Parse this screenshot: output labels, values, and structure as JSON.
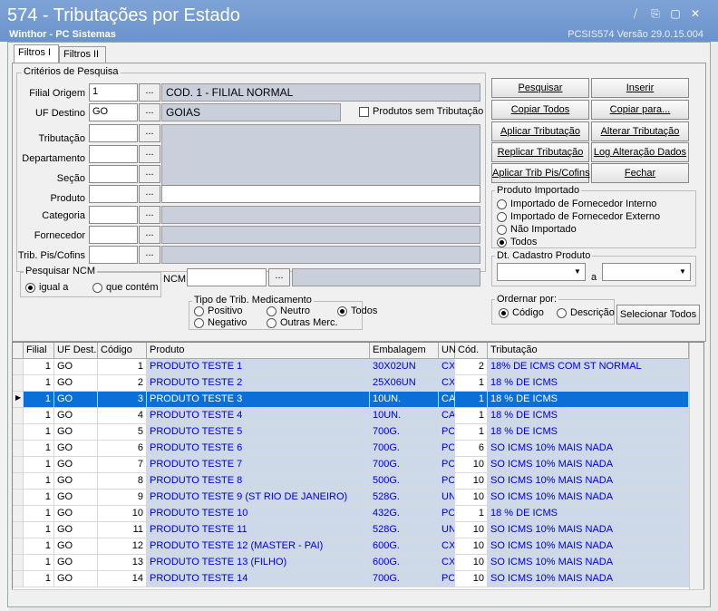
{
  "window": {
    "title": "574 - Tributações por Estado",
    "subtitle": "Winthor - PC Sistemas",
    "version": "PCSIS574  Versão  29.0.15.004",
    "controls": [
      "⧸",
      "⎘",
      "▢",
      "✕"
    ]
  },
  "tabs": [
    {
      "label": "Filtros I"
    },
    {
      "label": "Filtros II"
    }
  ],
  "criteria": {
    "group_label": "Critérios de Pesquisa",
    "filial_label": "Filial Origem",
    "filial_value": "1",
    "filial_desc": "COD. 1 - FILIAL NORMAL",
    "uf_label": "UF Destino",
    "uf_value": "GO",
    "uf_desc": "GOIAS",
    "sem_trib_label": "Produtos sem Tributação",
    "tributacao_label": "Tributação",
    "departamento_label": "Departamento",
    "secao_label": "Seção",
    "produto_label": "Produto",
    "categoria_label": "Categoria",
    "fornecedor_label": "Fornecedor",
    "pis_label": "Trib. Pis/Cofins",
    "dots": "..."
  },
  "ncm": {
    "group_label": "Pesquisar NCM",
    "igual_label": "igual a",
    "contem_label": "que contém",
    "ncm_label": "NCM"
  },
  "medicamento": {
    "group_label": "Tipo de Trib. Medicamento",
    "positivo": "Positivo",
    "neutro": "Neutro",
    "todos": "Todos",
    "negativo": "Negativo",
    "outras": "Outras Merc."
  },
  "buttons": {
    "pesquisar": "Pesquisar",
    "inserir": "Inserir",
    "copiar_todos": "Copiar Todos",
    "copiar_para": "Copiar para...",
    "aplicar_trib": "Aplicar Tributação",
    "alterar_trib": "Alterar Tributação",
    "replicar_trib": "Replicar Tributação",
    "log_alteracao": "Log Alteração Dados",
    "aplicar_pis": "Aplicar Trib Pis/Cofins",
    "fechar": "Fechar",
    "selecionar_todos": "Selecionar Todos"
  },
  "importado": {
    "group_label": "Produto Importado",
    "options": [
      "Importado de Fornecedor Interno",
      "Importado de Fornecedor Externo",
      "Não Importado",
      "Todos"
    ],
    "selected": "Todos"
  },
  "cadastro": {
    "group_label": "Dt. Cadastro Produto",
    "a_label": "a"
  },
  "ordenar": {
    "group_label": "Ordernar por:",
    "codigo": "Código",
    "descricao": "Descrição"
  },
  "grid": {
    "columns": [
      "Filial",
      "UF Dest.",
      "Código",
      "Produto",
      "Embalagem",
      "UN",
      "Cód.",
      "Tributação"
    ],
    "selected_row": 2,
    "rows": [
      [
        "1",
        "GO",
        "1",
        "PRODUTO TESTE 1",
        "30X02UN",
        "CX",
        "2",
        "18% DE ICMS COM ST NORMAL"
      ],
      [
        "1",
        "GO",
        "2",
        "PRODUTO TESTE 2",
        "25X06UN",
        "CX",
        "1",
        "18 % DE ICMS"
      ],
      [
        "1",
        "GO",
        "3",
        "PRODUTO TESTE 3",
        "10UN.",
        "CA",
        "1",
        "18 % DE ICMS"
      ],
      [
        "1",
        "GO",
        "4",
        "PRODUTO TESTE 4",
        "10UN.",
        "CA",
        "1",
        "18 % DE ICMS"
      ],
      [
        "1",
        "GO",
        "5",
        "PRODUTO TESTE 5",
        "700G.",
        "PC",
        "1",
        "18 % DE ICMS"
      ],
      [
        "1",
        "GO",
        "6",
        "PRODUTO TESTE 6",
        "700G.",
        "PC",
        "6",
        "SO ICMS 10% MAIS NADA"
      ],
      [
        "1",
        "GO",
        "7",
        "PRODUTO TESTE 7",
        "700G.",
        "PC",
        "10",
        "SO ICMS 10% MAIS NADA"
      ],
      [
        "1",
        "GO",
        "8",
        "PRODUTO TESTE 8",
        "500G.",
        "PC",
        "10",
        "SO ICMS 10% MAIS NADA"
      ],
      [
        "1",
        "GO",
        "9",
        "PRODUTO TESTE 9 (ST RIO DE JANEIRO)",
        "528G.",
        "UN",
        "10",
        "SO ICMS 10% MAIS NADA"
      ],
      [
        "1",
        "GO",
        "10",
        "PRODUTO TESTE 10",
        "432G.",
        "PC",
        "1",
        "18 % DE ICMS"
      ],
      [
        "1",
        "GO",
        "11",
        "PRODUTO TESTE 11",
        "528G.",
        "UN",
        "10",
        "SO ICMS 10% MAIS NADA"
      ],
      [
        "1",
        "GO",
        "12",
        "PRODUTO TESTE 12 (MASTER - PAI)",
        "600G.",
        "CX",
        "10",
        "SO ICMS 10% MAIS NADA"
      ],
      [
        "1",
        "GO",
        "13",
        "PRODUTO TESTE 13 (FILHO)",
        "600G.",
        "CX",
        "10",
        "SO ICMS 10% MAIS NADA"
      ],
      [
        "1",
        "GO",
        "14",
        "PRODUTO TESTE 14",
        "700G.",
        "PC",
        "10",
        "SO ICMS 10% MAIS NADA"
      ]
    ]
  },
  "colors": {
    "titlebar": "#6b93cc",
    "selection": "#0a6fd6",
    "link_text": "#0000d0",
    "desc_bg": "#c9d0dc"
  }
}
